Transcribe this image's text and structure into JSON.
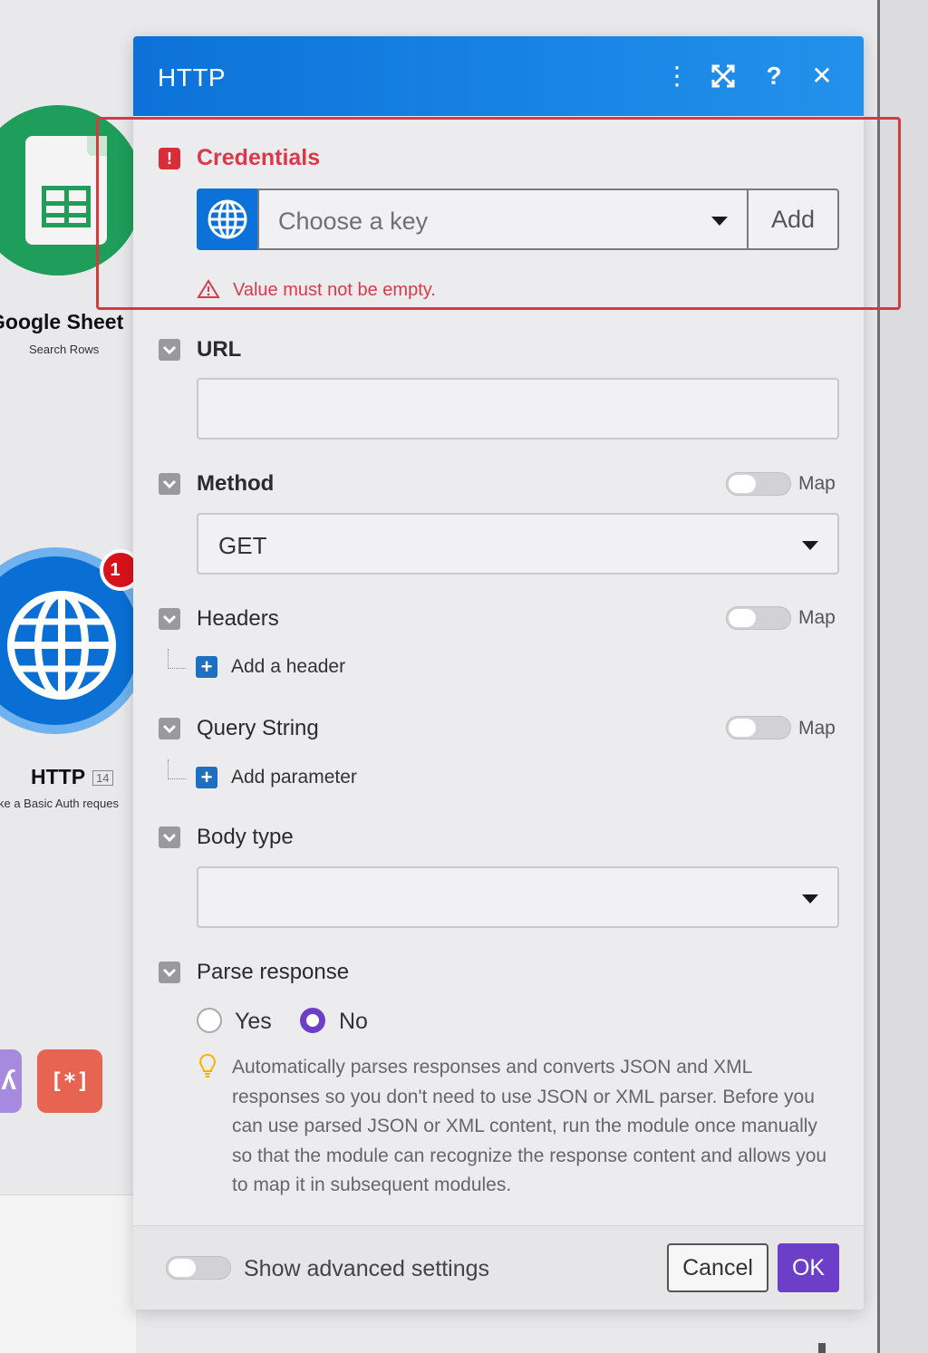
{
  "canvas": {
    "sheets_module": {
      "title": "Google Sheet",
      "subtitle": "Search Rows"
    },
    "http_module": {
      "title": "HTTP",
      "id": "14",
      "subtitle": "ke a Basic Auth reques",
      "badge": "1"
    },
    "tool_tiles": {
      "red_tile_label": "[*]"
    }
  },
  "dialog": {
    "title": "HTTP",
    "header_icons": [
      "more-vertical-icon",
      "expand-icon",
      "help-icon",
      "close-icon"
    ],
    "credentials": {
      "label": "Credentials",
      "placeholder": "Choose a key",
      "add_label": "Add",
      "error": "Value must not be empty."
    },
    "url": {
      "label": "URL",
      "value": ""
    },
    "method": {
      "label": "Method",
      "map_label": "Map",
      "value": "GET"
    },
    "headers": {
      "label": "Headers",
      "map_label": "Map",
      "add_label": "Add a header"
    },
    "query_string": {
      "label": "Query String",
      "map_label": "Map",
      "add_label": "Add parameter"
    },
    "body_type": {
      "label": "Body type",
      "value": ""
    },
    "parse_response": {
      "label": "Parse response",
      "options": [
        "Yes",
        "No"
      ],
      "selected": "No",
      "hint": "Automatically parses responses and converts JSON and XML responses so you don't need to use JSON or XML parser. Before you can use parsed JSON or XML content, run the module once manually so that the module can recognize the response content and allows you to map it in subsequent modules."
    },
    "footer": {
      "advanced_label": "Show advanced settings",
      "cancel_label": "Cancel",
      "ok_label": "OK"
    }
  },
  "colors": {
    "header_blue": "#0c72d9",
    "error_red": "#d93a4a",
    "primary_purple": "#6d3fc9",
    "highlight_red": "#d63b3b"
  }
}
